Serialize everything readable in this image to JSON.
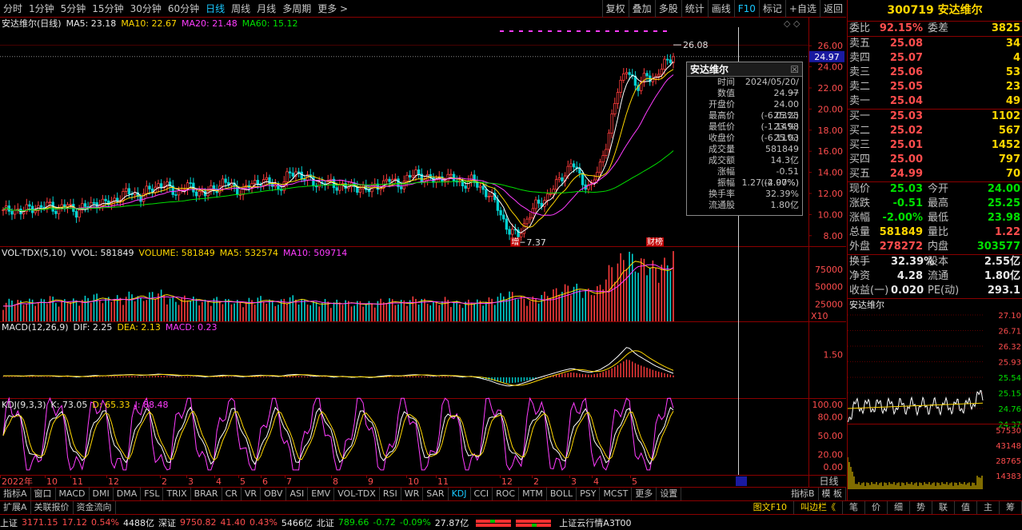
{
  "toolbar": {
    "periods": [
      "分时",
      "1分钟",
      "5分钟",
      "15分钟",
      "30分钟",
      "60分钟",
      "日线",
      "周线",
      "月线",
      "多周期",
      "更多 >"
    ],
    "active_period": "日线",
    "right_items": [
      "复权",
      "叠加",
      "多股",
      "统计",
      "画线",
      "F10",
      "标记",
      "+自选",
      "返回"
    ]
  },
  "legend": {
    "main": {
      "title": "安达维尔(日线)",
      "ma5": "MA5: 23.18",
      "ma10": "MA10: 22.67",
      "ma20": "MA20: 21.48",
      "ma60": "MA60: 15.12"
    },
    "vol": {
      "title": "VOL-TDX(5,10)",
      "vvol": "VVOL: 581849",
      "volume": "VOLUME: 581849",
      "ma5": "MA5: 532574",
      "ma10": "MA10: 509714"
    },
    "macd": {
      "title": "MACD(12,26,9)",
      "dif": "DIF: 2.25",
      "dea": "DEA: 2.13",
      "macd": "MACD: 0.23"
    },
    "kdj": {
      "title": "KDJ(9,3,3)",
      "k": "K: 73.05",
      "d": "D: 65.33",
      "j": "J: 88.48"
    }
  },
  "chart_data": [
    {
      "type": "candlestick",
      "title": "安达维尔(日线)",
      "ylim": [
        7,
        27
      ],
      "y_ticks": [
        "26.00",
        "24.00",
        "22.00",
        "20.00",
        "18.00",
        "16.00",
        "14.00",
        "12.00",
        "10.00",
        "8.00"
      ],
      "current_price_tag": "24.97",
      "annotations": [
        "26.08",
        "7.37",
        "增",
        "财榜"
      ],
      "x_ticks": [
        "2022年",
        "10",
        "11",
        "12",
        "2",
        "3",
        "4",
        "5",
        "6",
        "7",
        "8",
        "9",
        "10",
        "11",
        "12",
        "2",
        "3",
        "4",
        "5"
      ],
      "series": [
        {
          "name": "MA5",
          "color": "#ffffff"
        },
        {
          "name": "MA10",
          "color": "#ffd700"
        },
        {
          "name": "MA20",
          "color": "#ff3cff"
        },
        {
          "name": "MA60",
          "color": "#00e000"
        }
      ],
      "close_path": [
        10.2,
        10.6,
        10.1,
        10.8,
        10.5,
        11.0,
        10.4,
        10.9,
        10.3,
        10.7,
        11.2,
        10.9,
        11.4,
        11.8,
        12.2,
        11.6,
        12.4,
        12.9,
        12.5,
        12.1,
        12.7,
        12.3,
        11.9,
        12.5,
        13.1,
        12.6,
        12.2,
        12.8,
        13.3,
        12.9,
        12.5,
        13.6,
        14.1,
        13.4,
        12.8,
        13.2,
        12.6,
        12.9,
        12.4,
        12.7,
        12.2,
        12.9,
        13.3,
        12.8,
        13.4,
        13.9,
        13.5,
        13.1,
        13.7,
        13.3,
        12.9,
        13.2,
        12.6,
        11.8,
        10.5,
        8.5,
        7.9,
        9.5,
        10.8,
        11.5,
        12.5,
        13.8,
        14.9,
        13.2,
        12.6,
        14.5,
        17.9,
        21.9,
        24.2,
        21.5,
        23.6,
        22.4,
        24.6,
        24.97
      ]
    },
    {
      "type": "bar",
      "title": "VOL-TDX(5,10)",
      "y_ticks": [
        "75000",
        "50000",
        "25000"
      ],
      "unit_tag": "X10",
      "values": [
        22,
        30,
        25,
        28,
        26,
        34,
        24,
        29,
        27,
        31,
        35,
        28,
        33,
        30,
        38,
        29,
        36,
        40,
        31,
        27,
        33,
        29,
        26,
        30,
        28,
        27,
        25,
        29,
        31,
        27,
        24,
        33,
        30,
        26,
        24,
        27,
        25,
        28,
        23,
        26,
        24,
        27,
        29,
        25,
        28,
        31,
        27,
        24,
        30,
        26,
        23,
        28,
        26,
        29,
        33,
        38,
        34,
        27,
        31,
        36,
        40,
        44,
        48,
        42,
        39,
        45,
        68,
        78,
        92,
        74,
        80,
        71,
        76,
        88
      ]
    },
    {
      "type": "bar",
      "title": "MACD(12,26,9)",
      "y_ticks": [
        "1.50"
      ],
      "values": [
        0.05,
        0.06,
        0.02,
        0.08,
        0.04,
        0.07,
        0.0,
        0.05,
        -0.03,
        0.02,
        0.08,
        0.05,
        0.1,
        0.12,
        0.15,
        0.08,
        0.13,
        0.18,
        0.12,
        0.06,
        0.1,
        0.05,
        -0.02,
        0.04,
        0.1,
        0.06,
        -0.02,
        0.05,
        0.1,
        0.06,
        0.0,
        0.12,
        0.16,
        0.1,
        0.02,
        0.06,
        -0.04,
        0.02,
        -0.06,
        0.0,
        -0.08,
        0.02,
        0.08,
        0.03,
        0.1,
        0.14,
        0.1,
        0.04,
        0.1,
        0.05,
        -0.03,
        0.02,
        -0.12,
        -0.3,
        -0.55,
        -0.7,
        -0.62,
        -0.4,
        -0.15,
        0.05,
        0.25,
        0.45,
        0.6,
        0.4,
        0.3,
        0.5,
        0.9,
        1.5,
        2.2,
        1.6,
        1.2,
        0.8,
        0.5,
        0.23
      ]
    },
    {
      "type": "line",
      "title": "KDJ(9,3,3)",
      "y_ticks": [
        "100.00",
        "80.00",
        "50.00",
        "20.00",
        "0.00"
      ],
      "series": [
        {
          "name": "K",
          "color": "#ffffff"
        },
        {
          "name": "D",
          "color": "#ffd700"
        },
        {
          "name": "J",
          "color": "#ff3cff"
        }
      ]
    }
  ],
  "popup": {
    "title": "安达维尔",
    "rows": [
      [
        "时间",
        "2024/05/20/一"
      ],
      [
        "数值",
        "24.97"
      ],
      [
        "开盘价",
        "24.00 (-6.03%)"
      ],
      [
        "最高价",
        "25.25 (-1.14%)"
      ],
      [
        "最低价",
        "23.98 (-6.11%)"
      ],
      [
        "收盘价",
        "25.03"
      ],
      [
        "成交量",
        "581849"
      ],
      [
        "成交额",
        "14.3亿"
      ],
      [
        "涨幅",
        "-0.51 (-2.00%)"
      ],
      [
        "振幅",
        "1.27 (4.97%)"
      ],
      [
        "换手率",
        "32.39%"
      ],
      [
        "流通股",
        "1.80亿"
      ]
    ]
  },
  "quote": {
    "header": "300719 安达维尔",
    "weibi_label": "委比",
    "weibi": "92.15%",
    "weicha_label": "委差",
    "weicha": "3825",
    "sells": [
      {
        "l": "卖五",
        "p": "25.08",
        "v": "34"
      },
      {
        "l": "卖四",
        "p": "25.07",
        "v": "4"
      },
      {
        "l": "卖三",
        "p": "25.06",
        "v": "53"
      },
      {
        "l": "卖二",
        "p": "25.05",
        "v": "23"
      },
      {
        "l": "卖一",
        "p": "25.04",
        "v": "49"
      }
    ],
    "buys": [
      {
        "l": "买一",
        "p": "25.03",
        "v": "1102"
      },
      {
        "l": "买二",
        "p": "25.02",
        "v": "567"
      },
      {
        "l": "买三",
        "p": "25.01",
        "v": "1452"
      },
      {
        "l": "买四",
        "p": "25.00",
        "v": "797"
      },
      {
        "l": "买五",
        "p": "24.99",
        "v": "70"
      }
    ],
    "stats": [
      {
        "k": "现价",
        "a": "25.03",
        "ac": "g",
        "k2": "今开",
        "b": "24.00",
        "bc": "g"
      },
      {
        "k": "涨跌",
        "a": "-0.51",
        "ac": "g",
        "k2": "最高",
        "b": "25.25",
        "bc": "g"
      },
      {
        "k": "涨幅",
        "a": "-2.00%",
        "ac": "g",
        "k2": "最低",
        "b": "23.98",
        "bc": "g"
      },
      {
        "k": "总量",
        "a": "581849",
        "ac": "y",
        "k2": "量比",
        "b": "1.22",
        "bc": "r"
      },
      {
        "k": "外盘",
        "a": "278272",
        "ac": "r",
        "k2": "内盘",
        "b": "303577",
        "bc": "g"
      }
    ],
    "stats2": [
      {
        "k": "换手",
        "a": "32.39%",
        "k2": "股本",
        "b": "2.55亿"
      },
      {
        "k": "净资",
        "a": "4.28",
        "k2": "流通",
        "b": "1.80亿"
      },
      {
        "k": "收益(一)",
        "a": "0.020",
        "k2": "PE(动)",
        "b": "293.1"
      }
    ],
    "mini_title": "安达维尔",
    "mini_prices": [
      "27.10",
      "26.71",
      "26.32",
      "25.93",
      "25.54",
      "25.15",
      "24.76",
      "24.37"
    ],
    "mini_vols": [
      "57530",
      "43148",
      "28765",
      "14383"
    ]
  },
  "bottom_tabs": [
    "指标A",
    "窗口",
    "MACD",
    "DMI",
    "DMA",
    "FSL",
    "TRIX",
    "BRAR",
    "CR",
    "VR",
    "OBV",
    "ASI",
    "EMV",
    "VOL-TDX",
    "RSI",
    "WR",
    "SAR",
    "KDJ",
    "CCI",
    "ROC",
    "MTM",
    "BOLL",
    "PSY",
    "MCST",
    "更多",
    "设置"
  ],
  "active_tab": "KDJ",
  "bottom_right": [
    "指标B",
    "模 板"
  ],
  "period_label": "日线",
  "ext_tabs": [
    "扩展A",
    "关联报价",
    "资金流向"
  ],
  "ext_right": [
    "图文F10",
    "叫边栏《",
    "笔",
    "价",
    "细",
    "势",
    "联",
    "值",
    "主",
    "筹"
  ],
  "status": {
    "sh_label": "上证",
    "sh": "3171.15",
    "sh_chg": "17.12",
    "sh_pct": "0.54%",
    "sh_amt": "4488亿",
    "sz_label": "深证",
    "sz": "9750.82",
    "sz_chg": "41.40",
    "sz_pct": "0.43%",
    "sz_amt": "5466亿",
    "bz_label": "北证",
    "bz": "789.66",
    "bz_chg": "-0.72",
    "bz_pct": "-0.09%",
    "bz_amt": "27.87亿",
    "feed": "上证云行情A3T00"
  }
}
